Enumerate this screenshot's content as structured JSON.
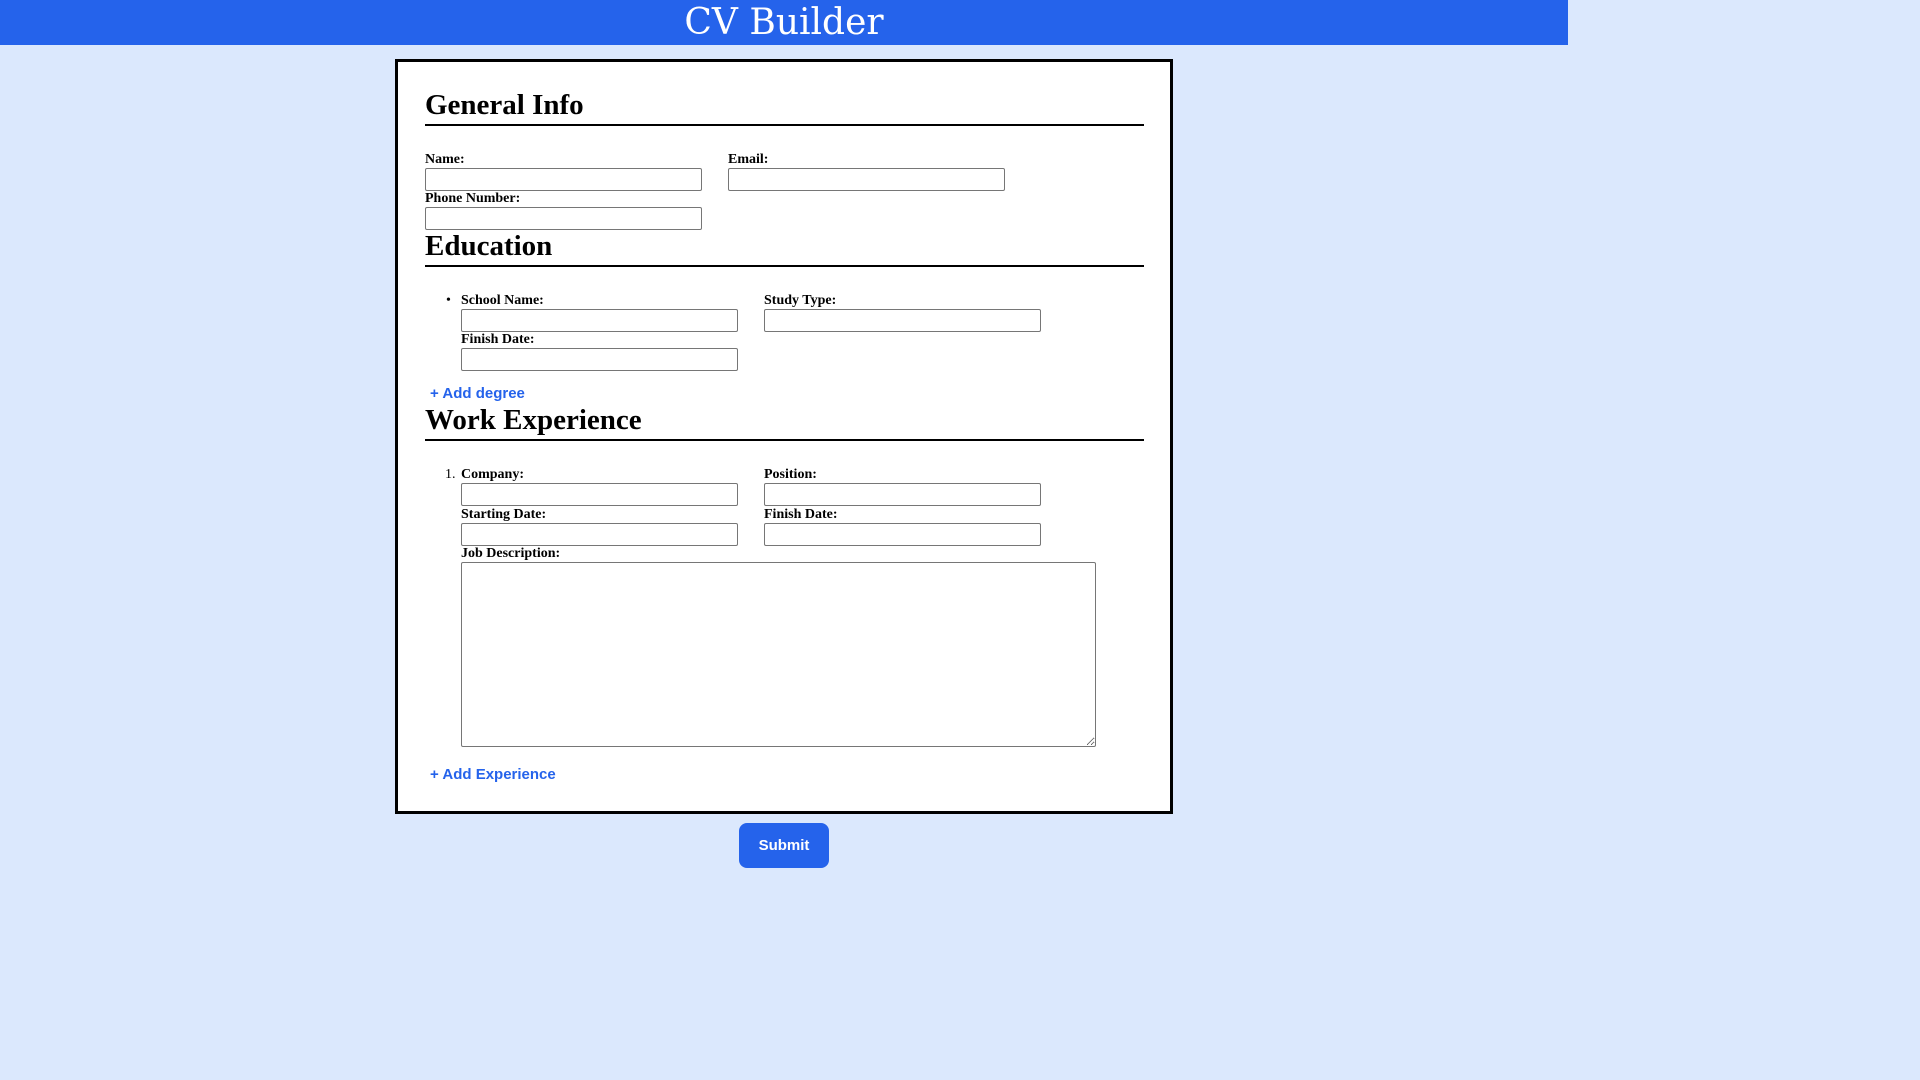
{
  "header": {
    "title": "CV Builder"
  },
  "general_info": {
    "title": "General Info",
    "name_label": "Name:",
    "name_value": "",
    "email_label": "Email:",
    "email_value": "",
    "phone_label": "Phone Number:",
    "phone_value": ""
  },
  "education": {
    "title": "Education",
    "list_marker": "•",
    "items": [
      {
        "school_label": "School Name:",
        "school_value": "",
        "study_label": "Study Type:",
        "study_value": "",
        "finish_label": "Finish Date:",
        "finish_value": ""
      }
    ],
    "add_label": "+ Add degree"
  },
  "work": {
    "title": "Work Experience",
    "items": [
      {
        "number": "1.",
        "company_label": "Company:",
        "company_value": "",
        "position_label": "Position:",
        "position_value": "",
        "start_label": "Starting Date:",
        "start_value": "",
        "finish_label": "Finish Date:",
        "finish_value": "",
        "description_label": "Job Description:",
        "description_value": ""
      }
    ],
    "add_label": "+ Add Experience"
  },
  "submit_label": "Submit",
  "colors": {
    "accent": "#2563eb",
    "page_background": "#dbe8fd",
    "card_background": "#ffffff",
    "card_border": "#000000"
  }
}
